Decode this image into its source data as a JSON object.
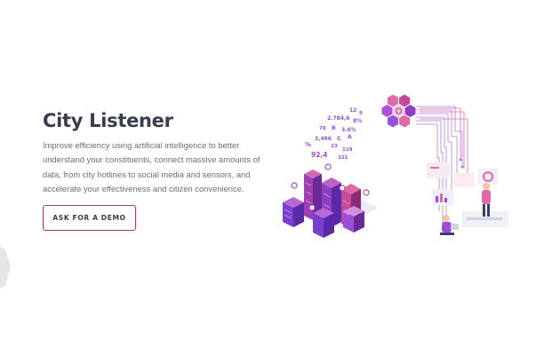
{
  "hero": {
    "title": "City Listener",
    "description": "Improve efficiency using artificial intelligence to better understand your constituents, connect massive amounts of data, from city hotlines to social media and sensors, and accelerate your effectiveness and citizen convenience.",
    "cta_label": "ASK FOR A DEMO"
  },
  "illustration": {
    "floating_data": [
      "12",
      "9",
      "2.784,6",
      "8%",
      "78",
      "B",
      "3.6%",
      "3,486",
      "C",
      "A",
      "%",
      "23",
      "119",
      "92,4",
      "321"
    ],
    "colors": {
      "accent": "#a8376a",
      "purple": "#7b3fd0",
      "magenta": "#c44a9a",
      "hex_pink": "#e06aa8",
      "hex_violet": "#9a4fd8"
    }
  }
}
